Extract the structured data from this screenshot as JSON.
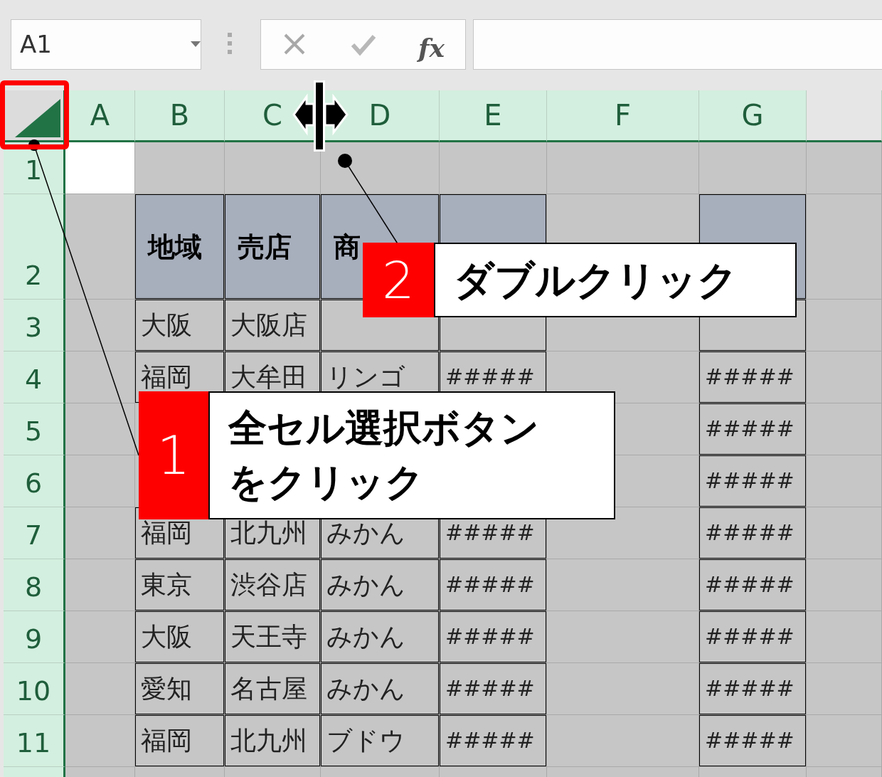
{
  "name_box": {
    "value": "A1"
  },
  "formula_bar": {
    "function_label": "fx"
  },
  "column_headers": [
    {
      "label": "A",
      "selected": true
    },
    {
      "label": "B",
      "selected": true
    },
    {
      "label": "C",
      "selected": true
    },
    {
      "label": "D",
      "selected": true
    },
    {
      "label": "E",
      "selected": true
    },
    {
      "label": "F",
      "selected": true
    },
    {
      "label": "G",
      "selected": true
    }
  ],
  "rows": [
    {
      "header": "1",
      "selected": true,
      "cells": [
        {
          "active": true
        },
        null,
        null,
        null,
        null,
        null,
        null
      ]
    },
    {
      "header": "2",
      "selected": true,
      "cells": [
        null,
        {
          "text": "地域",
          "framed": true,
          "header": true
        },
        {
          "text": "売店",
          "framed": true,
          "header": true
        },
        {
          "text": "商",
          "framed": true,
          "header": true
        },
        {
          "framed": true,
          "header": true
        },
        null,
        {
          "framed": true,
          "header": true
        }
      ]
    },
    {
      "header": "3",
      "selected": true,
      "cells": [
        null,
        {
          "text": "大阪",
          "framed": true
        },
        {
          "text": "大阪店",
          "framed": true
        },
        {
          "framed": true
        },
        {
          "framed": true
        },
        null,
        {
          "framed": true
        }
      ]
    },
    {
      "header": "4",
      "selected": true,
      "cells": [
        null,
        {
          "text": "福岡",
          "framed": true
        },
        {
          "text": "大牟田",
          "framed": true
        },
        {
          "text": "リンゴ",
          "framed": true
        },
        {
          "text": "#####",
          "framed": true
        },
        null,
        {
          "text": "#####",
          "framed": true
        }
      ]
    },
    {
      "header": "5",
      "selected": true,
      "cells": [
        null,
        null,
        null,
        null,
        null,
        null,
        {
          "text": "#####",
          "framed": true
        }
      ]
    },
    {
      "header": "6",
      "selected": true,
      "cells": [
        null,
        null,
        null,
        null,
        null,
        null,
        {
          "text": "#####",
          "framed": true
        }
      ]
    },
    {
      "header": "7",
      "selected": true,
      "cells": [
        null,
        {
          "text": "福岡",
          "framed": true
        },
        {
          "text": "北九州",
          "framed": true
        },
        {
          "text": "みかん",
          "framed": true
        },
        {
          "text": "#####",
          "framed": true
        },
        null,
        {
          "text": "#####",
          "framed": true
        }
      ]
    },
    {
      "header": "8",
      "selected": true,
      "cells": [
        null,
        {
          "text": "東京",
          "framed": true
        },
        {
          "text": "渋谷店",
          "framed": true
        },
        {
          "text": "みかん",
          "framed": true
        },
        {
          "text": "#####",
          "framed": true
        },
        null,
        {
          "text": "#####",
          "framed": true
        }
      ]
    },
    {
      "header": "9",
      "selected": true,
      "cells": [
        null,
        {
          "text": "大阪",
          "framed": true
        },
        {
          "text": "天王寺",
          "framed": true
        },
        {
          "text": "みかん",
          "framed": true
        },
        {
          "text": "#####",
          "framed": true
        },
        null,
        {
          "text": "#####",
          "framed": true
        }
      ]
    },
    {
      "header": "10",
      "selected": true,
      "cells": [
        null,
        {
          "text": "愛知",
          "framed": true
        },
        {
          "text": "名古屋",
          "framed": true
        },
        {
          "text": "みかん",
          "framed": true
        },
        {
          "text": "#####",
          "framed": true
        },
        null,
        {
          "text": "#####",
          "framed": true
        }
      ]
    },
    {
      "header": "11",
      "selected": true,
      "cells": [
        null,
        {
          "text": "福岡",
          "framed": true
        },
        {
          "text": "北九州",
          "framed": true
        },
        {
          "text": "ブドウ",
          "framed": true
        },
        {
          "text": "#####",
          "framed": true
        },
        null,
        {
          "text": "#####",
          "framed": true
        }
      ]
    }
  ],
  "callouts": [
    {
      "number": "1",
      "lines": [
        "全セル選択ボタン",
        "をクリック"
      ]
    },
    {
      "number": "2",
      "lines": [
        "ダブルクリック"
      ]
    }
  ]
}
